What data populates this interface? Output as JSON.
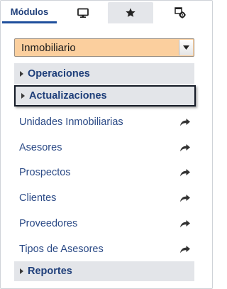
{
  "tabs": [
    {
      "label": "Módulos",
      "active": true
    },
    {
      "icon": "monitor-icon"
    },
    {
      "icon": "star-icon",
      "selected": true
    },
    {
      "icon": "settings-window-icon"
    }
  ],
  "module_select": {
    "value": "Inmobiliario",
    "background": "#fbcf9e"
  },
  "sections": {
    "operaciones": "Operaciones",
    "actualizaciones": "Actualizaciones",
    "reportes": "Reportes"
  },
  "items": [
    {
      "label": "Unidades Inmobiliarias",
      "icon": "share-arrow-icon"
    },
    {
      "label": "Asesores",
      "icon": "share-arrow-icon"
    },
    {
      "label": "Prospectos",
      "icon": "share-arrow-icon"
    },
    {
      "label": "Clientes",
      "icon": "share-arrow-icon"
    },
    {
      "label": "Proveedores",
      "icon": "share-arrow-icon"
    },
    {
      "label": "Tipos de Asesores",
      "icon": "share-arrow-icon"
    }
  ],
  "colors": {
    "accent": "#1f4f9c",
    "link": "#2b4a86",
    "section_bg": "#e3e5e9"
  }
}
